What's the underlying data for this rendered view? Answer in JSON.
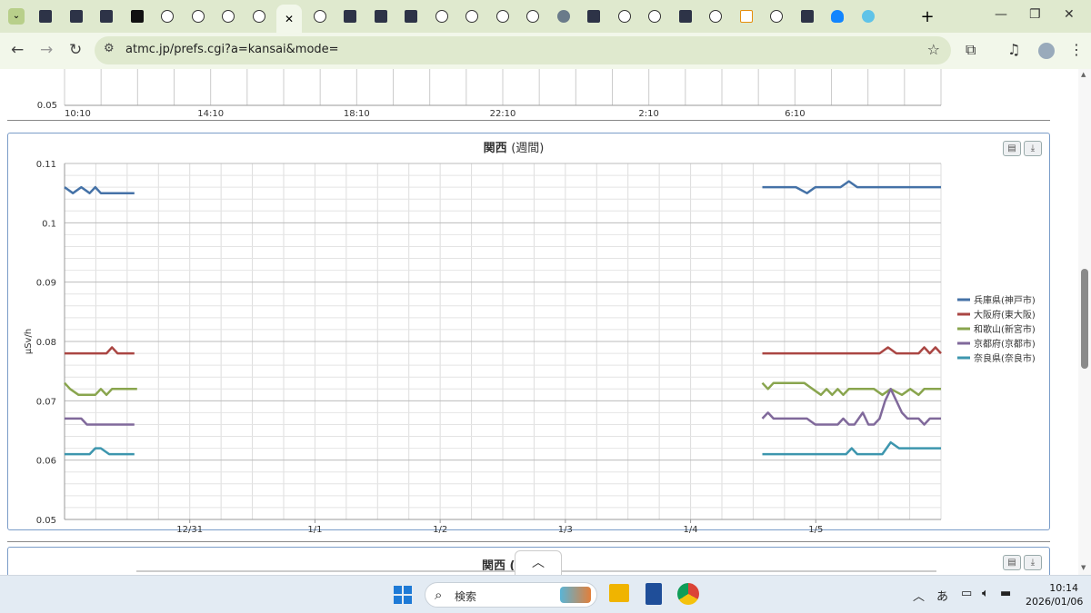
{
  "browser": {
    "url": "atmc.jp/prefs.cgi?a=kansai&mode=",
    "close_glyph": "✕",
    "new_tab_glyph": "+"
  },
  "top_chart": {
    "y_label_bottom": "0.05",
    "x_ticks": [
      "10:10",
      "14:10",
      "18:10",
      "22:10",
      "2:10",
      "6:10"
    ]
  },
  "chart_data": {
    "type": "line",
    "title": "関西",
    "title_suffix": "(週間)",
    "ylabel": "μSv/h",
    "ylim": [
      0.05,
      0.11
    ],
    "y_ticks": [
      "0.11",
      "0.1",
      "0.09",
      "0.08",
      "0.07",
      "0.06",
      "0.05"
    ],
    "x_tick_labels": [
      "12/31",
      "1/1",
      "1/2",
      "1/3",
      "1/4",
      "1/5"
    ],
    "legend_position": "right",
    "series": [
      {
        "name": "兵庫県(神戸市)",
        "color": "#4572a7",
        "segments": [
          [
            [
              0.0,
              0.106
            ],
            [
              0.03,
              0.105
            ],
            [
              0.06,
              0.106
            ],
            [
              0.09,
              0.105
            ],
            [
              0.11,
              0.106
            ],
            [
              0.13,
              0.105
            ],
            [
              0.25,
              0.105
            ]
          ],
          [
            [
              2.5,
              0.106
            ],
            [
              2.62,
              0.106
            ],
            [
              2.66,
              0.105
            ],
            [
              2.69,
              0.106
            ],
            [
              2.78,
              0.106
            ],
            [
              2.81,
              0.107
            ],
            [
              2.84,
              0.106
            ],
            [
              3.14,
              0.106
            ]
          ]
        ]
      },
      {
        "name": "大阪府(東大阪)",
        "color": "#aa4643",
        "segments": [
          [
            [
              0.0,
              0.078
            ],
            [
              0.15,
              0.078
            ],
            [
              0.17,
              0.079
            ],
            [
              0.19,
              0.078
            ],
            [
              0.25,
              0.078
            ]
          ],
          [
            [
              2.5,
              0.078
            ],
            [
              2.92,
              0.078
            ],
            [
              2.95,
              0.079
            ],
            [
              2.98,
              0.078
            ],
            [
              3.06,
              0.078
            ],
            [
              3.08,
              0.079
            ],
            [
              3.1,
              0.078
            ],
            [
              3.12,
              0.079
            ],
            [
              3.14,
              0.078
            ]
          ]
        ]
      },
      {
        "name": "和歌山(新宮市)",
        "color": "#89a54e",
        "segments": [
          [
            [
              0.0,
              0.073
            ],
            [
              0.02,
              0.072
            ],
            [
              0.05,
              0.071
            ],
            [
              0.11,
              0.071
            ],
            [
              0.13,
              0.072
            ],
            [
              0.15,
              0.071
            ],
            [
              0.17,
              0.072
            ],
            [
              0.26,
              0.072
            ]
          ],
          [
            [
              2.5,
              0.073
            ],
            [
              2.52,
              0.072
            ],
            [
              2.54,
              0.073
            ],
            [
              2.65,
              0.073
            ],
            [
              2.68,
              0.072
            ],
            [
              2.71,
              0.071
            ],
            [
              2.73,
              0.072
            ],
            [
              2.75,
              0.071
            ],
            [
              2.77,
              0.072
            ],
            [
              2.79,
              0.071
            ],
            [
              2.81,
              0.072
            ],
            [
              2.9,
              0.072
            ],
            [
              2.93,
              0.071
            ],
            [
              2.96,
              0.072
            ],
            [
              3.0,
              0.071
            ],
            [
              3.03,
              0.072
            ],
            [
              3.06,
              0.071
            ],
            [
              3.08,
              0.072
            ],
            [
              3.14,
              0.072
            ]
          ]
        ]
      },
      {
        "name": "京都府(京都市)",
        "color": "#80699b",
        "segments": [
          [
            [
              0.0,
              0.067
            ],
            [
              0.06,
              0.067
            ],
            [
              0.08,
              0.066
            ],
            [
              0.25,
              0.066
            ]
          ],
          [
            [
              2.5,
              0.067
            ],
            [
              2.52,
              0.068
            ],
            [
              2.54,
              0.067
            ],
            [
              2.66,
              0.067
            ],
            [
              2.69,
              0.066
            ],
            [
              2.77,
              0.066
            ],
            [
              2.79,
              0.067
            ],
            [
              2.81,
              0.066
            ],
            [
              2.83,
              0.066
            ],
            [
              2.86,
              0.068
            ],
            [
              2.88,
              0.066
            ],
            [
              2.9,
              0.066
            ],
            [
              2.92,
              0.067
            ],
            [
              2.94,
              0.07
            ],
            [
              2.96,
              0.072
            ],
            [
              2.98,
              0.07
            ],
            [
              3.0,
              0.068
            ],
            [
              3.02,
              0.067
            ],
            [
              3.06,
              0.067
            ],
            [
              3.08,
              0.066
            ],
            [
              3.1,
              0.067
            ],
            [
              3.14,
              0.067
            ]
          ]
        ]
      },
      {
        "name": "奈良県(奈良市)",
        "color": "#3d96ae",
        "segments": [
          [
            [
              0.0,
              0.061
            ],
            [
              0.09,
              0.061
            ],
            [
              0.11,
              0.062
            ],
            [
              0.13,
              0.062
            ],
            [
              0.16,
              0.061
            ],
            [
              0.25,
              0.061
            ]
          ],
          [
            [
              2.5,
              0.061
            ],
            [
              2.8,
              0.061
            ],
            [
              2.82,
              0.062
            ],
            [
              2.84,
              0.061
            ],
            [
              2.93,
              0.061
            ],
            [
              2.96,
              0.063
            ],
            [
              2.99,
              0.062
            ],
            [
              3.14,
              0.062
            ]
          ]
        ]
      }
    ]
  },
  "bottom_panel": {
    "title_partial": "関西 ("
  },
  "taskbar": {
    "search_placeholder": "検索",
    "ime": "あ",
    "time": "10:14",
    "date": "2026/01/06"
  },
  "colors": {
    "tab_strip": "#dfe9ce",
    "toolbar": "#f2f7ea",
    "panel_border": "#7a9cc8",
    "grid": "#cccccc"
  }
}
